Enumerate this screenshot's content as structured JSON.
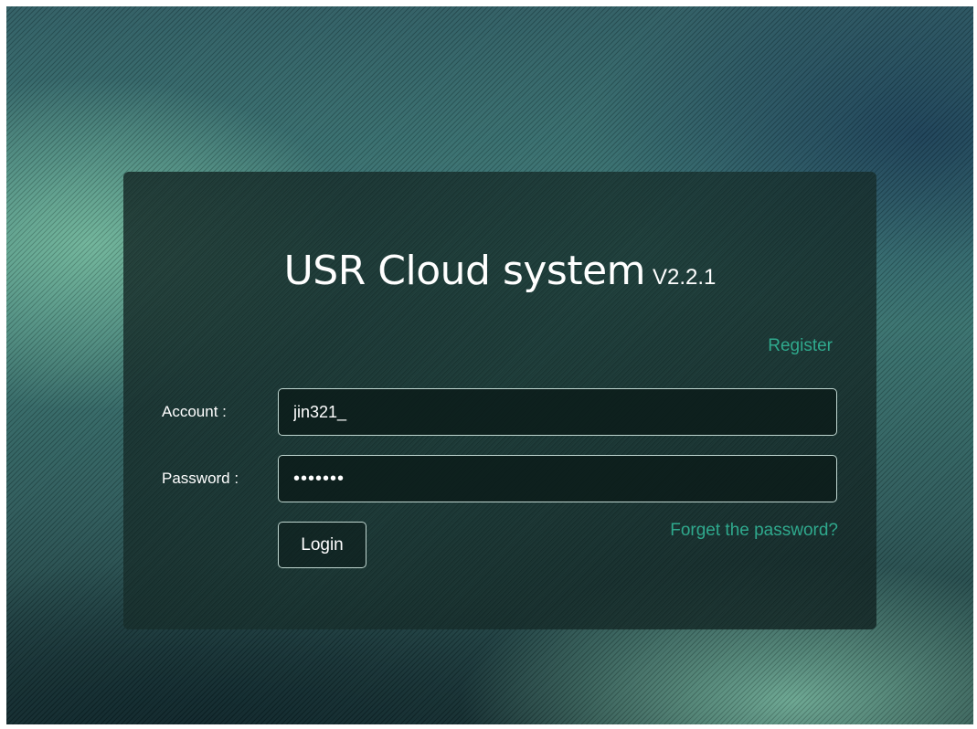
{
  "login": {
    "title": "USR Cloud system",
    "version": "V2.2.1",
    "register_link": "Register",
    "account_label": "Account :",
    "account_value": "jin321_",
    "password_label": "Password :",
    "password_value": "•••••••",
    "login_button": "Login",
    "forget_link": "Forget the password?"
  },
  "colors": {
    "accent": "#2fa98d",
    "card_bg": "#142a28",
    "text": "#ffffff"
  }
}
